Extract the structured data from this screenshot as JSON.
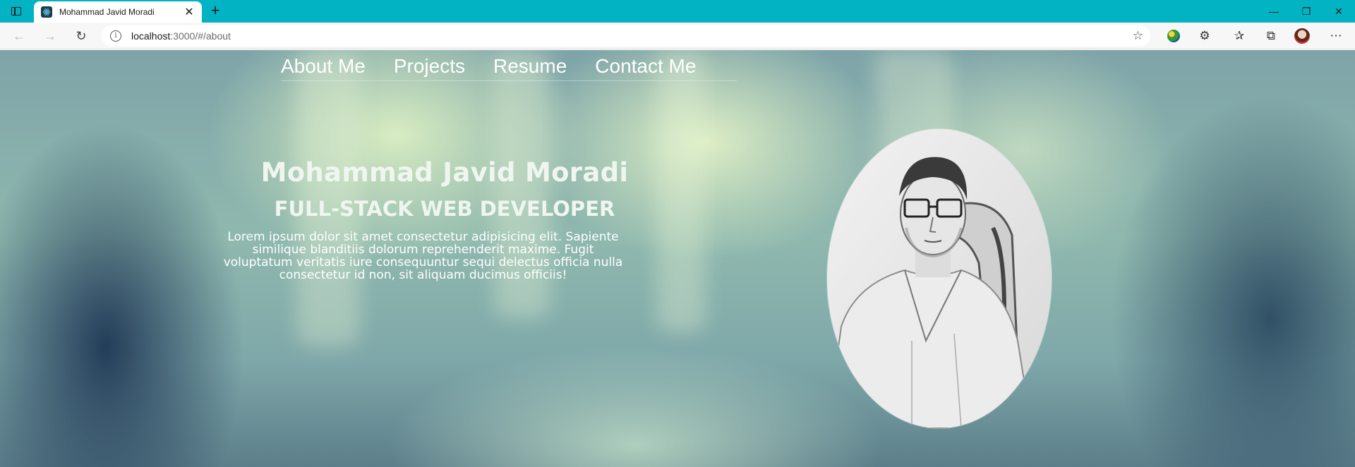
{
  "browser": {
    "tab_title": "Mohammad Javid Moradi",
    "url_host": "localhost",
    "url_path": ":3000/#/about"
  },
  "icons": {
    "window_menu": "window-menu-icon",
    "favicon": "react-icon",
    "tab_close": "close-icon",
    "new_tab": "plus-icon",
    "back": "back-arrow-icon",
    "forward": "forward-arrow-icon",
    "reload": "reload-icon",
    "site_info": "info-icon",
    "favorite_add": "star-add-icon",
    "extension_1": "globe-extension-icon",
    "extensions": "puzzle-icon",
    "favorites": "favorites-icon",
    "collections": "collections-icon",
    "profile": "profile-avatar-icon"
  },
  "nav": {
    "items": [
      "About Me",
      "Projects",
      "Resume",
      "Contact Me"
    ]
  },
  "hero": {
    "name": "Mohammad Javid Moradi",
    "role": "FULL-STACK WEB DEVELOPER",
    "description": "Lorem ipsum dolor sit amet consectetur adipisicing elit. Sapiente similique blanditiis dolorum reprehenderit maxime. Fugit voluptatum veritatis iure consequuntur sequi delectus officia nulla consectetur id non, sit aliquam ducimus officiis!"
  },
  "colors": {
    "titlebar": "#02b3c4",
    "nav_text": "#ffffff",
    "hero_text": "#eef6ef"
  }
}
